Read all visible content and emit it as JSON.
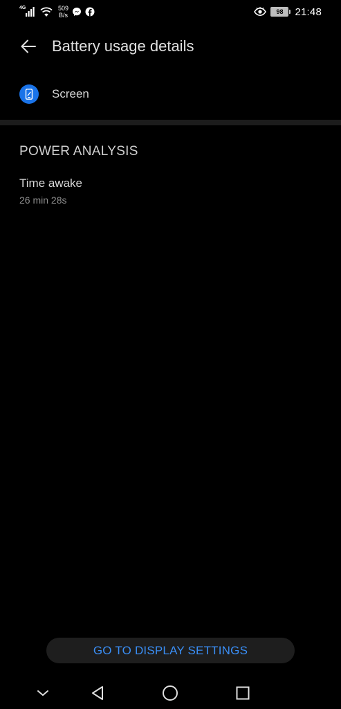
{
  "status_bar": {
    "network_type": "4G",
    "net_speed_value": "509",
    "net_speed_unit": "B/s",
    "battery_level": "98",
    "time": "21:48"
  },
  "header": {
    "title": "Battery usage details"
  },
  "app": {
    "name": "Screen"
  },
  "power_analysis": {
    "section_title": "POWER ANALYSIS",
    "time_awake_label": "Time awake",
    "time_awake_value": "26 min 28s"
  },
  "action_button": {
    "label": "GO TO DISPLAY SETTINGS"
  },
  "colors": {
    "background": "#000000",
    "accent": "#3a8ef5",
    "app_icon": "#1a73e8",
    "divider": "#1c1c1c",
    "button_bg": "#1e1e1e"
  },
  "icons": {
    "back": "arrow-left-icon",
    "app": "phone-screen-icon",
    "messenger": "messenger-icon",
    "facebook": "facebook-icon",
    "eye_comfort": "eye-icon",
    "nav_collapse": "chevron-down-icon",
    "nav_back": "triangle-back-icon",
    "nav_home": "circle-home-icon",
    "nav_recents": "square-recents-icon"
  }
}
